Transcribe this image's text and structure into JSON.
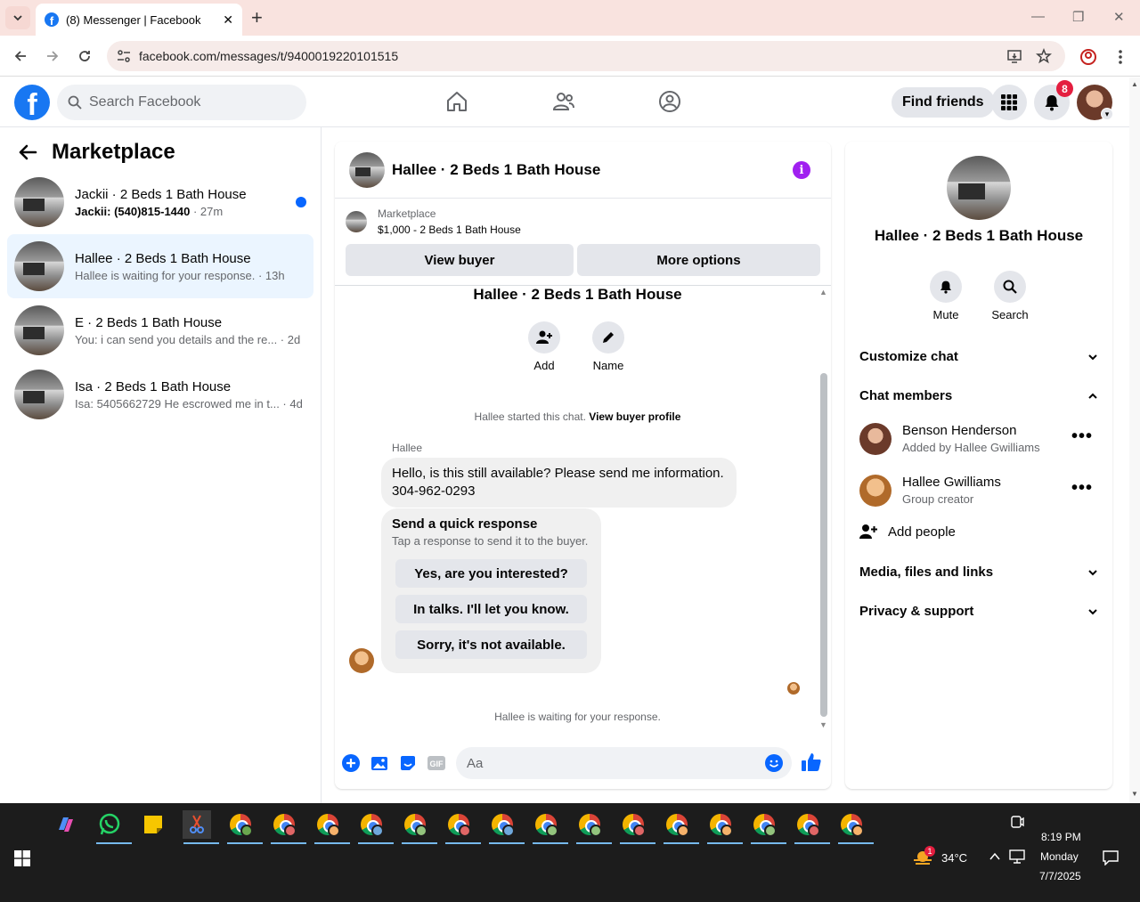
{
  "browser": {
    "tab_title": "(8) Messenger | Facebook",
    "url": "facebook.com/messages/t/9400019220101515"
  },
  "header": {
    "search_placeholder": "Search Facebook",
    "find_friends": "Find friends",
    "notification_count": "8"
  },
  "sidebar": {
    "title": "Marketplace",
    "conversations": [
      {
        "name": "Jackii · 2 Beds 1 Bath House",
        "preview": "Jackii: (540)815-1440",
        "time": " · 27m",
        "unread": true
      },
      {
        "name": "Hallee · 2 Beds 1 Bath House",
        "preview": "Hallee is waiting for your response.",
        "time": " · 13h",
        "unread": false
      },
      {
        "name": "E · 2 Beds 1 Bath House",
        "preview": "You: i can send you details and the re...",
        "time": " · 2d",
        "unread": false
      },
      {
        "name": "Isa · 2 Beds 1 Bath House",
        "preview": "Isa: 5405662729 He escrowed me in t...",
        "time": " · 4d",
        "unread": false
      }
    ]
  },
  "chat": {
    "title": "Hallee · 2 Beds 1 Bath House",
    "marketplace_label": "Marketplace",
    "listing": "$1,000 - 2 Beds 1 Bath House",
    "view_buyer": "View buyer",
    "more_options": "More options",
    "center_title": "Hallee · 2 Beds 1 Bath House",
    "actions": [
      {
        "label": "Add"
      },
      {
        "label": "Name"
      }
    ],
    "started_text": "Hallee started this chat.",
    "view_buyer_profile": "View buyer profile",
    "sender": "Hallee",
    "message_line1": "Hello, is this still available? Please send me information.",
    "message_line2": "304-962-0293",
    "quick_title": "Send a quick response",
    "quick_sub": "Tap a response to send it to the buyer.",
    "quick_responses": [
      "Yes, are you interested?",
      "In talks. I'll let you know.",
      "Sorry, it's not available."
    ],
    "waiting": "Hallee is waiting for your response.",
    "composer_placeholder": "Aa"
  },
  "details": {
    "title": "Hallee · 2 Beds 1 Bath House",
    "mute": "Mute",
    "search": "Search",
    "customize_chat": "Customize chat",
    "chat_members": "Chat members",
    "members": [
      {
        "name": "Benson Henderson",
        "sub": "Added by Hallee Gwilliams"
      },
      {
        "name": "Hallee Gwilliams",
        "sub": "Group creator"
      }
    ],
    "add_people": "Add people",
    "media": "Media, files and links",
    "privacy": "Privacy & support"
  },
  "taskbar": {
    "temperature": "34°C",
    "weather_badge": "1",
    "time": "8:19 PM",
    "day": "Monday",
    "date": "7/7/2025"
  },
  "colors": {
    "facebook_blue": "#1877f2",
    "messenger_blue": "#0866ff",
    "active_row": "#ebf5ff",
    "info_purple": "#a020f0"
  }
}
